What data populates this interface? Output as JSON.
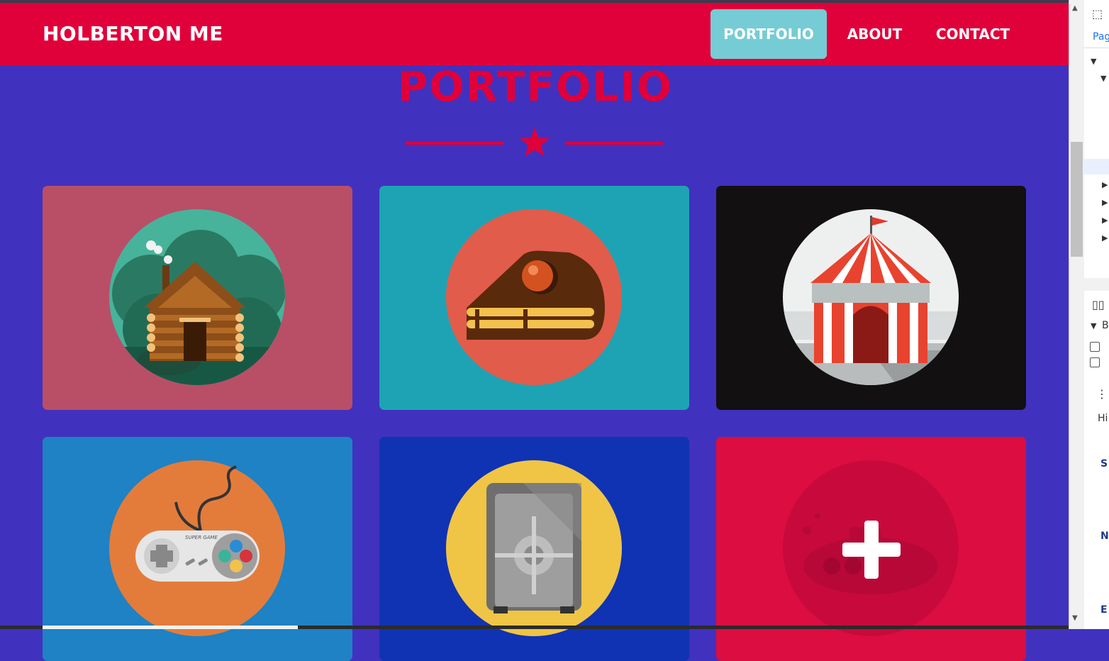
{
  "navbar": {
    "brand": "HOLBERTON ME",
    "items": [
      {
        "label": "PORTFOLIO",
        "active": true
      },
      {
        "label": "ABOUT",
        "active": false
      },
      {
        "label": "CONTACT",
        "active": false
      }
    ]
  },
  "section": {
    "title": "PORTFOLIO",
    "divider_icon": "star-icon"
  },
  "portfolio_items": [
    {
      "icon": "log-cabin-icon",
      "background": "#b84f67"
    },
    {
      "icon": "cake-slice-icon",
      "background": "#1ea3b4"
    },
    {
      "icon": "circus-tent-icon",
      "background": "#121010"
    },
    {
      "icon": "game-controller-icon",
      "background": "#1e82c4",
      "controller_text": "SUPER GAME"
    },
    {
      "icon": "safe-icon",
      "background": "#1033b4"
    },
    {
      "icon": "submarine-icon",
      "background": "#dc0d40",
      "hover_icon": "plus-icon"
    }
  ],
  "devtools": {
    "tab_partial": "Pag",
    "text_hi": "Hi",
    "text_s": "S",
    "text_n": "N",
    "text_e": "E",
    "text_b": "B"
  },
  "colors": {
    "page_background": "#4131bf",
    "navbar": "#e0003a",
    "active_nav": "#76ccd4",
    "heading": "#e0003a"
  }
}
